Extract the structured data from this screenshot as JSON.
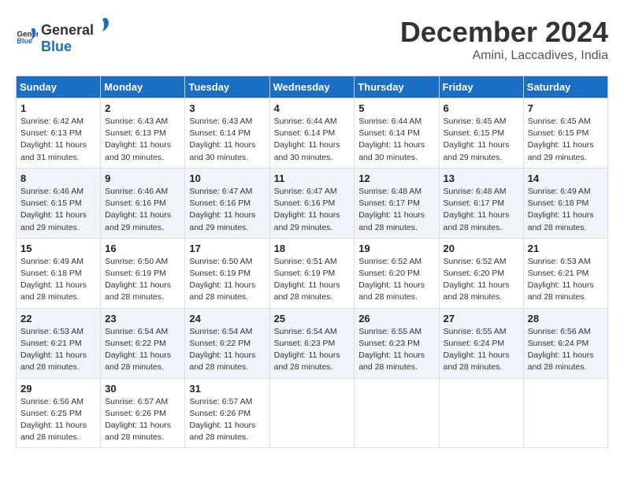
{
  "header": {
    "logo_general": "General",
    "logo_blue": "Blue",
    "month_title": "December 2024",
    "location": "Amini, Laccadives, India"
  },
  "days_of_week": [
    "Sunday",
    "Monday",
    "Tuesday",
    "Wednesday",
    "Thursday",
    "Friday",
    "Saturday"
  ],
  "weeks": [
    [
      {
        "day": "1",
        "sunrise": "6:42 AM",
        "sunset": "6:13 PM",
        "daylight": "11 hours and 31 minutes."
      },
      {
        "day": "2",
        "sunrise": "6:43 AM",
        "sunset": "6:13 PM",
        "daylight": "11 hours and 30 minutes."
      },
      {
        "day": "3",
        "sunrise": "6:43 AM",
        "sunset": "6:14 PM",
        "daylight": "11 hours and 30 minutes."
      },
      {
        "day": "4",
        "sunrise": "6:44 AM",
        "sunset": "6:14 PM",
        "daylight": "11 hours and 30 minutes."
      },
      {
        "day": "5",
        "sunrise": "6:44 AM",
        "sunset": "6:14 PM",
        "daylight": "11 hours and 30 minutes."
      },
      {
        "day": "6",
        "sunrise": "6:45 AM",
        "sunset": "6:15 PM",
        "daylight": "11 hours and 29 minutes."
      },
      {
        "day": "7",
        "sunrise": "6:45 AM",
        "sunset": "6:15 PM",
        "daylight": "11 hours and 29 minutes."
      }
    ],
    [
      {
        "day": "8",
        "sunrise": "6:46 AM",
        "sunset": "6:15 PM",
        "daylight": "11 hours and 29 minutes."
      },
      {
        "day": "9",
        "sunrise": "6:46 AM",
        "sunset": "6:16 PM",
        "daylight": "11 hours and 29 minutes."
      },
      {
        "day": "10",
        "sunrise": "6:47 AM",
        "sunset": "6:16 PM",
        "daylight": "11 hours and 29 minutes."
      },
      {
        "day": "11",
        "sunrise": "6:47 AM",
        "sunset": "6:16 PM",
        "daylight": "11 hours and 29 minutes."
      },
      {
        "day": "12",
        "sunrise": "6:48 AM",
        "sunset": "6:17 PM",
        "daylight": "11 hours and 28 minutes."
      },
      {
        "day": "13",
        "sunrise": "6:48 AM",
        "sunset": "6:17 PM",
        "daylight": "11 hours and 28 minutes."
      },
      {
        "day": "14",
        "sunrise": "6:49 AM",
        "sunset": "6:18 PM",
        "daylight": "11 hours and 28 minutes."
      }
    ],
    [
      {
        "day": "15",
        "sunrise": "6:49 AM",
        "sunset": "6:18 PM",
        "daylight": "11 hours and 28 minutes."
      },
      {
        "day": "16",
        "sunrise": "6:50 AM",
        "sunset": "6:19 PM",
        "daylight": "11 hours and 28 minutes."
      },
      {
        "day": "17",
        "sunrise": "6:50 AM",
        "sunset": "6:19 PM",
        "daylight": "11 hours and 28 minutes."
      },
      {
        "day": "18",
        "sunrise": "6:51 AM",
        "sunset": "6:19 PM",
        "daylight": "11 hours and 28 minutes."
      },
      {
        "day": "19",
        "sunrise": "6:52 AM",
        "sunset": "6:20 PM",
        "daylight": "11 hours and 28 minutes."
      },
      {
        "day": "20",
        "sunrise": "6:52 AM",
        "sunset": "6:20 PM",
        "daylight": "11 hours and 28 minutes."
      },
      {
        "day": "21",
        "sunrise": "6:53 AM",
        "sunset": "6:21 PM",
        "daylight": "11 hours and 28 minutes."
      }
    ],
    [
      {
        "day": "22",
        "sunrise": "6:53 AM",
        "sunset": "6:21 PM",
        "daylight": "11 hours and 28 minutes."
      },
      {
        "day": "23",
        "sunrise": "6:54 AM",
        "sunset": "6:22 PM",
        "daylight": "11 hours and 28 minutes."
      },
      {
        "day": "24",
        "sunrise": "6:54 AM",
        "sunset": "6:22 PM",
        "daylight": "11 hours and 28 minutes."
      },
      {
        "day": "25",
        "sunrise": "6:54 AM",
        "sunset": "6:23 PM",
        "daylight": "11 hours and 28 minutes."
      },
      {
        "day": "26",
        "sunrise": "6:55 AM",
        "sunset": "6:23 PM",
        "daylight": "11 hours and 28 minutes."
      },
      {
        "day": "27",
        "sunrise": "6:55 AM",
        "sunset": "6:24 PM",
        "daylight": "11 hours and 28 minutes."
      },
      {
        "day": "28",
        "sunrise": "6:56 AM",
        "sunset": "6:24 PM",
        "daylight": "11 hours and 28 minutes."
      }
    ],
    [
      {
        "day": "29",
        "sunrise": "6:56 AM",
        "sunset": "6:25 PM",
        "daylight": "11 hours and 28 minutes."
      },
      {
        "day": "30",
        "sunrise": "6:57 AM",
        "sunset": "6:26 PM",
        "daylight": "11 hours and 28 minutes."
      },
      {
        "day": "31",
        "sunrise": "6:57 AM",
        "sunset": "6:26 PM",
        "daylight": "11 hours and 28 minutes."
      },
      null,
      null,
      null,
      null
    ]
  ]
}
